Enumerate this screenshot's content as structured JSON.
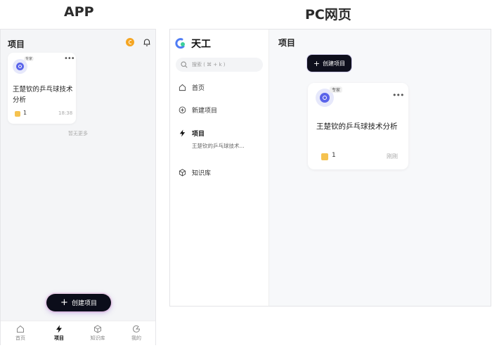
{
  "headings": {
    "app": "APP",
    "pc": "PC网页"
  },
  "app": {
    "title": "项目",
    "card": {
      "tag": "专家",
      "title": "王楚钦的乒乓球技术分析",
      "count": "1",
      "time": "18:38"
    },
    "no_more": "暂无更多",
    "create_button": "创建项目",
    "tabs": [
      {
        "label": "首页",
        "icon": "home-icon"
      },
      {
        "label": "项目",
        "icon": "lightning-icon"
      },
      {
        "label": "知识库",
        "icon": "cube-icon"
      },
      {
        "label": "我的",
        "icon": "user-icon"
      }
    ]
  },
  "pc": {
    "logo": "天工",
    "search_placeholder": "搜索 ( ⌘ + k )",
    "nav": [
      {
        "label": "首页",
        "icon": "home-icon"
      },
      {
        "label": "新建项目",
        "icon": "plus-circle-icon"
      },
      {
        "label": "项目",
        "icon": "lightning-icon"
      },
      {
        "label": "知识库",
        "icon": "cube-icon"
      }
    ],
    "nav_sub": "王楚钦的乒乓球技术...",
    "main_title": "项目",
    "create_button": "创建项目",
    "card": {
      "tag": "专家",
      "title": "王楚钦的乒乓球技术分析",
      "count": "1",
      "time": "刚刚"
    }
  },
  "colors": {
    "accent": "#5a64ea",
    "button_dark": "#0e0f1c",
    "coin": "#f5a623"
  }
}
